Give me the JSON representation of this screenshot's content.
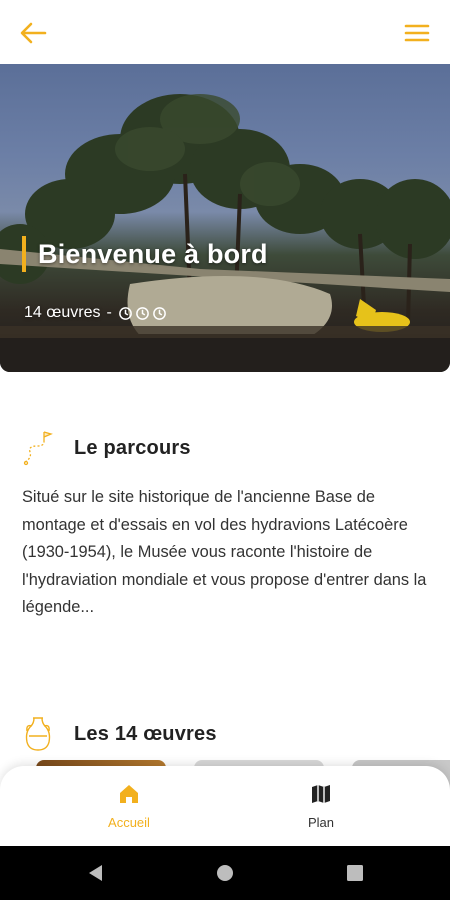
{
  "appbar": {
    "back_icon": "arrow-left-icon",
    "menu_icon": "hamburger-menu-icon",
    "accent": "#f2b01e"
  },
  "hero": {
    "title": "Bienvenue à bord",
    "count_text": "14 œuvres",
    "separator": "-",
    "duration_icons": [
      "timer-icon",
      "timer-icon",
      "timer-icon"
    ]
  },
  "parcours": {
    "icon": "route-icon",
    "title": "Le parcours",
    "text": "Situé sur le site historique de l'ancienne Base de montage et d'essais en vol des hydravions Latécoère (1930-1954), le Musée vous raconte l'histoire de l'hydraviation mondiale et vous propose d'entrer dans la légende..."
  },
  "oeuvres": {
    "icon": "vase-icon",
    "title": "Les 14 œuvres"
  },
  "bottom_nav": {
    "items": [
      {
        "label": "Accueil",
        "icon": "home-icon",
        "active": true
      },
      {
        "label": "Plan",
        "icon": "map-icon",
        "active": false
      }
    ]
  },
  "system_nav": {
    "back": "back-triangle-icon",
    "home": "home-circle-icon",
    "recents": "recents-square-icon"
  }
}
